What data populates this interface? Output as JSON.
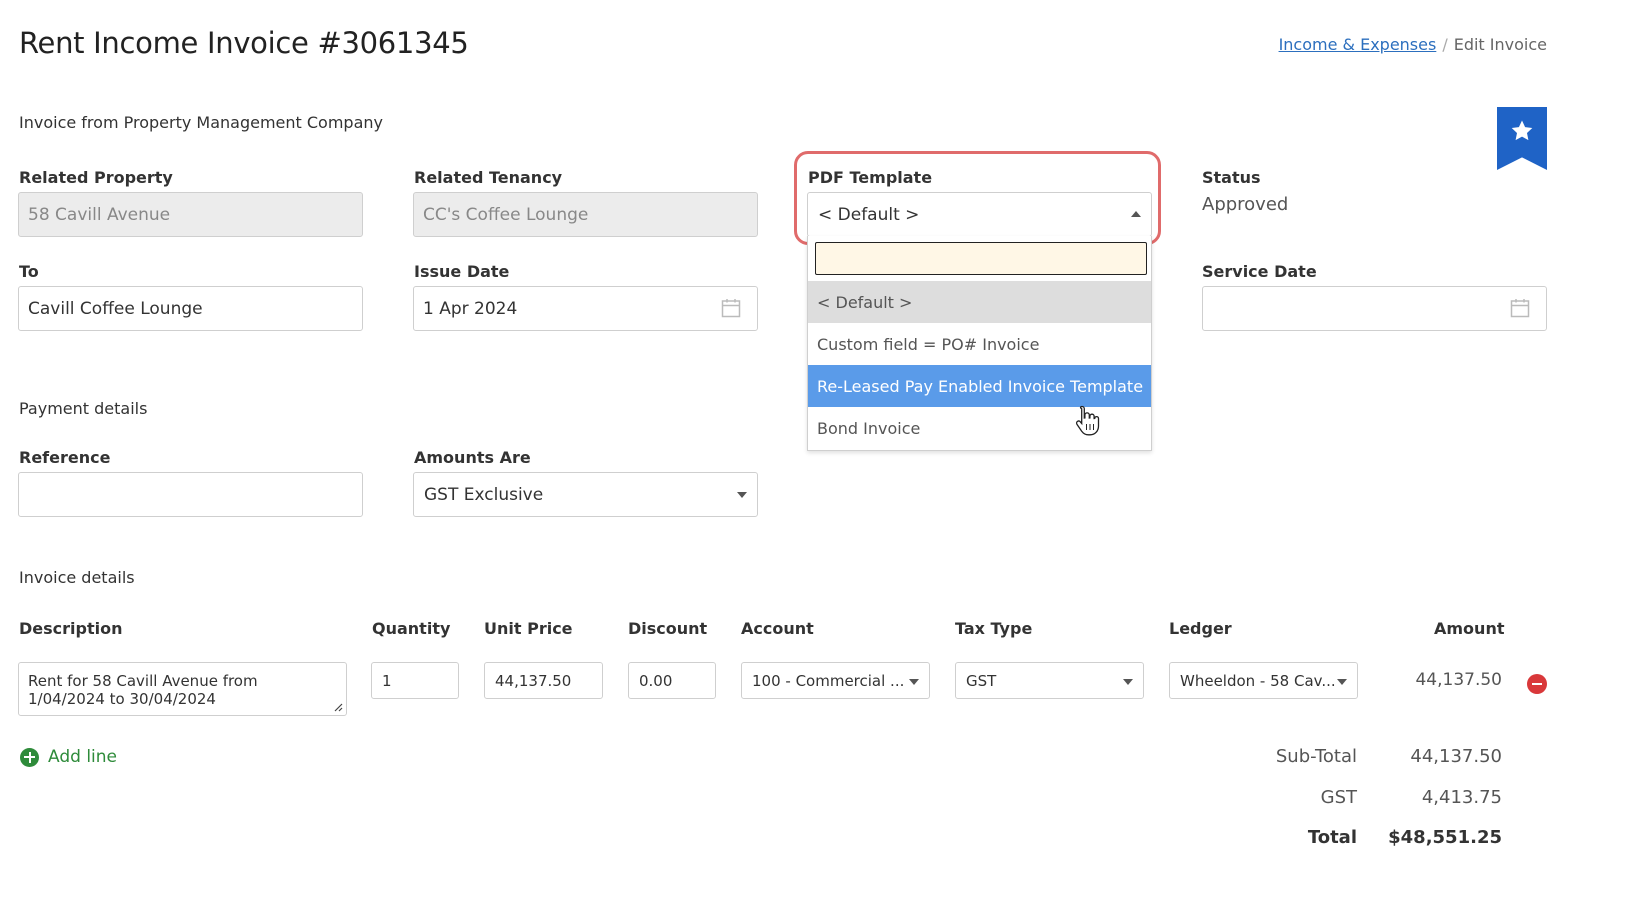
{
  "header": {
    "title": "Rent Income Invoice #3061345",
    "breadcrumb": {
      "link": "Income & Expenses",
      "separator": "/",
      "current": "Edit Invoice"
    }
  },
  "bookmark": {
    "icon": "star-icon",
    "color": "#1f63c6"
  },
  "invoice_from": {
    "heading": "Invoice from Property Management Company"
  },
  "fields": {
    "related_property": {
      "label": "Related Property",
      "value": "58 Cavill Avenue"
    },
    "related_tenancy": {
      "label": "Related Tenancy",
      "value": "CC's Coffee Lounge"
    },
    "pdf_template": {
      "label": "PDF Template",
      "value": "< Default >",
      "search_value": "",
      "options": [
        "< Default >",
        "Custom field = PO# Invoice",
        "Re-Leased Pay Enabled Invoice Template",
        "Bond Invoice"
      ],
      "selected_index": 0,
      "hover_index": 2
    },
    "status": {
      "label": "Status",
      "value": "Approved"
    },
    "to": {
      "label": "To",
      "value": "Cavill Coffee Lounge"
    },
    "issue_date": {
      "label": "Issue Date",
      "value": "1 Apr 2024"
    },
    "service_date": {
      "label": "Service Date",
      "value": ""
    }
  },
  "payment": {
    "heading": "Payment details",
    "reference": {
      "label": "Reference",
      "value": ""
    },
    "amounts_are": {
      "label": "Amounts Are",
      "value": "GST Exclusive"
    }
  },
  "invoice_details": {
    "heading": "Invoice details",
    "columns": [
      "Description",
      "Quantity",
      "Unit Price",
      "Discount",
      "Account",
      "Tax Type",
      "Ledger",
      "Amount"
    ],
    "lines": [
      {
        "description": "Rent for 58 Cavill Avenue from 1/04/2024 to 30/04/2024",
        "quantity": "1",
        "unit_price": "44,137.50",
        "discount": "0.00",
        "account": "100 - Commercial ...",
        "tax_type": "GST",
        "ledger": "Wheeldon - 58 Cav...",
        "amount": "44,137.50"
      }
    ],
    "add_line_label": "Add line"
  },
  "totals": {
    "sub_total_label": "Sub-Total",
    "sub_total": "44,137.50",
    "gst_label": "GST",
    "gst": "4,413.75",
    "total_label": "Total",
    "total": "$48,551.25"
  },
  "colors": {
    "accent": "#1f63c6",
    "link": "#2c6fbe",
    "highlight_ring": "#e06b6b",
    "hover_option": "#5a9be9",
    "add": "#2e8b3a",
    "remove": "#d9383a"
  }
}
